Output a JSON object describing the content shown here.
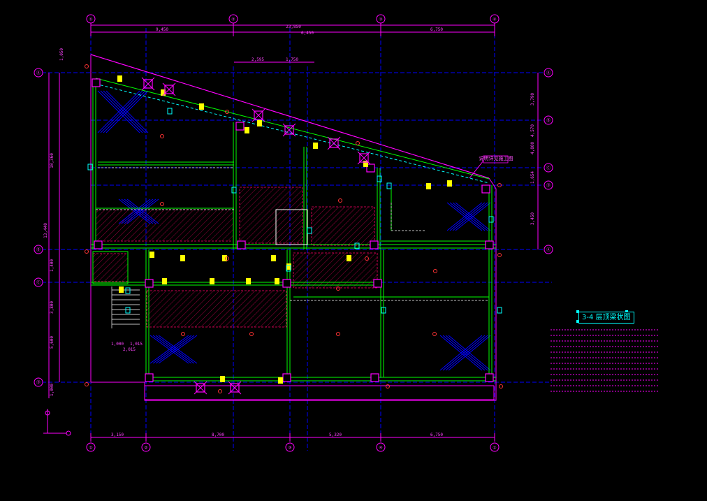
{
  "drawing": {
    "title": "3-4 层顶梁状图",
    "top_dims": [
      "9,450",
      "23,850",
      "6,450",
      "6,750"
    ],
    "top_mid_dims": [
      "2,595",
      "1,750"
    ],
    "bottom_dims": [
      "3,150",
      "8,700",
      "5,320",
      "6,750"
    ],
    "left_dims": [
      "1,050",
      "10,360",
      "13,440",
      "1,400",
      "3,800",
      "5,600",
      "1,000",
      "1,000",
      "1,015",
      "2,015"
    ],
    "right_dims": [
      "3,790",
      "4,570",
      "4,800",
      "1,654",
      "3,450"
    ],
    "callout": "说明详见施工图",
    "grid_top": [
      "①",
      "②",
      "③",
      "④"
    ],
    "grid_left": [
      "Ⓐ",
      "Ⓑ",
      "Ⓒ",
      "Ⓓ"
    ],
    "notes_lines": 12
  },
  "colors": {
    "background": "#000000",
    "grid": "#0000ff",
    "dimension": "#ff00ff",
    "wall": "#00ff00",
    "column": "#ff00ff",
    "label": "#ffff00",
    "accent": "#00ffff",
    "hatch": "#ff0066"
  }
}
